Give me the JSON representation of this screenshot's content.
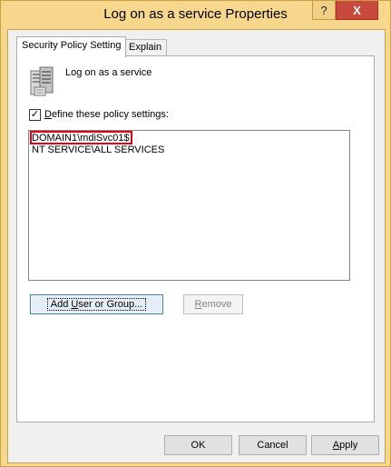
{
  "window": {
    "title": "Log on as a service Properties",
    "help_button": "?",
    "close_button": "X"
  },
  "tabs": [
    {
      "label": "Security Policy Setting",
      "active": true
    },
    {
      "label": "Explain",
      "active": false
    }
  ],
  "policy": {
    "icon": "server-policy-icon",
    "name": "Log on as a service"
  },
  "define_checkbox": {
    "checked": true,
    "mark": "✓",
    "label_prefix": "",
    "label_underlined": "D",
    "label_rest": "efine these policy settings:"
  },
  "accounts": [
    {
      "name": "DOMAIN1\\mdiSvc01$",
      "highlighted": true
    },
    {
      "name": "NT SERVICE\\ALL SERVICES",
      "highlighted": false
    }
  ],
  "buttons": {
    "add_prefix": "Add ",
    "add_underlined": "U",
    "add_rest": "ser or Group...",
    "remove_underlined": "R",
    "remove_rest": "emove",
    "ok": "OK",
    "cancel": "Cancel",
    "apply_prefix": "",
    "apply_underlined": "A",
    "apply_rest": "pply"
  },
  "colors": {
    "title_bar": "#f6d78c",
    "close_button": "#c74a3c",
    "highlight_box": "#e0001b"
  }
}
